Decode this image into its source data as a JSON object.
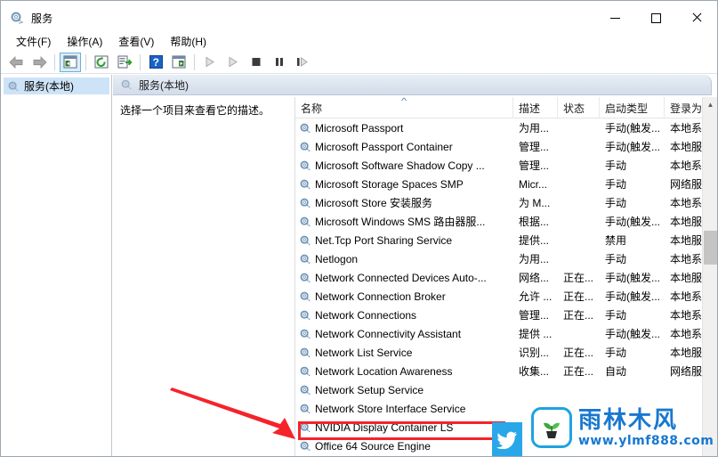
{
  "window": {
    "title": "服务",
    "icon": "services-gear-icon",
    "minimize_label": "最小化",
    "maximize_label": "最大化",
    "close_label": "关闭"
  },
  "menu": {
    "items": [
      {
        "label": "文件(F)",
        "name": "menu-file"
      },
      {
        "label": "操作(A)",
        "name": "menu-action"
      },
      {
        "label": "查看(V)",
        "name": "menu-view"
      },
      {
        "label": "帮助(H)",
        "name": "menu-help"
      }
    ]
  },
  "toolbar": {
    "buttons": [
      {
        "icon": "back-arrow-icon",
        "tooltip": "后退"
      },
      {
        "icon": "forward-arrow-icon",
        "tooltip": "前进"
      },
      {
        "icon": "show-tree-pane-icon",
        "tooltip": "显示/隐藏控制台树"
      },
      {
        "icon": "refresh-icon",
        "tooltip": "刷新"
      },
      {
        "icon": "export-list-icon",
        "tooltip": "导出列表"
      },
      {
        "icon": "help-icon",
        "tooltip": "帮助"
      },
      {
        "icon": "properties-icon",
        "tooltip": "属性"
      },
      {
        "icon": "start-service-icon",
        "tooltip": "启动服务"
      },
      {
        "icon": "restart-service-icon",
        "tooltip": "重启动服务"
      },
      {
        "icon": "stop-service-icon",
        "tooltip": "停止服务"
      },
      {
        "icon": "pause-service-icon",
        "tooltip": "暂停服务"
      },
      {
        "icon": "resume-service-icon",
        "tooltip": "恢复服务"
      }
    ]
  },
  "tree": {
    "root_label": "服务(本地)"
  },
  "right_pane": {
    "header_label": "服务(本地)",
    "description_placeholder": "选择一个项目来查看它的描述。"
  },
  "list": {
    "columns": [
      {
        "label": "名称",
        "name": "column-name",
        "sorted": "asc"
      },
      {
        "label": "描述",
        "name": "column-description"
      },
      {
        "label": "状态",
        "name": "column-status"
      },
      {
        "label": "启动类型",
        "name": "column-startup-type"
      },
      {
        "label": "登录为",
        "name": "column-log-on-as"
      }
    ],
    "rows": [
      {
        "name": "Microsoft Passport",
        "desc": "为用...",
        "status": "",
        "startup": "手动(触发...",
        "logon": "本地系"
      },
      {
        "name": "Microsoft Passport Container",
        "desc": "管理...",
        "status": "",
        "startup": "手动(触发...",
        "logon": "本地服"
      },
      {
        "name": "Microsoft Software Shadow Copy ...",
        "desc": "管理...",
        "status": "",
        "startup": "手动",
        "logon": "本地系"
      },
      {
        "name": "Microsoft Storage Spaces SMP",
        "desc": "Micr...",
        "status": "",
        "startup": "手动",
        "logon": "网络服"
      },
      {
        "name": "Microsoft Store 安装服务",
        "desc": "为 M...",
        "status": "",
        "startup": "手动",
        "logon": "本地系"
      },
      {
        "name": "Microsoft Windows SMS 路由器服...",
        "desc": "根据...",
        "status": "",
        "startup": "手动(触发...",
        "logon": "本地服"
      },
      {
        "name": "Net.Tcp Port Sharing Service",
        "desc": "提供...",
        "status": "",
        "startup": "禁用",
        "logon": "本地服"
      },
      {
        "name": "Netlogon",
        "desc": "为用...",
        "status": "",
        "startup": "手动",
        "logon": "本地系"
      },
      {
        "name": "Network Connected Devices Auto-...",
        "desc": "网络...",
        "status": "正在...",
        "startup": "手动(触发...",
        "logon": "本地服"
      },
      {
        "name": "Network Connection Broker",
        "desc": "允许 ...",
        "status": "正在...",
        "startup": "手动(触发...",
        "logon": "本地系"
      },
      {
        "name": "Network Connections",
        "desc": "管理...",
        "status": "正在...",
        "startup": "手动",
        "logon": "本地系"
      },
      {
        "name": "Network Connectivity Assistant",
        "desc": "提供 ...",
        "status": "",
        "startup": "手动(触发...",
        "logon": "本地系"
      },
      {
        "name": "Network List Service",
        "desc": "识别...",
        "status": "正在...",
        "startup": "手动",
        "logon": "本地服"
      },
      {
        "name": "Network Location Awareness",
        "desc": "收集...",
        "status": "正在...",
        "startup": "自动",
        "logon": "网络服"
      },
      {
        "name": "Network Setup Service",
        "desc": "",
        "status": "",
        "startup": "",
        "logon": ""
      },
      {
        "name": "Network Store Interface Service",
        "desc": "",
        "status": "",
        "startup": "",
        "logon": ""
      },
      {
        "name": "NVIDIA Display Container LS",
        "desc": "",
        "status": "",
        "startup": "",
        "logon": ""
      },
      {
        "name": "Office 64 Source Engine",
        "desc": "",
        "status": "",
        "startup": "",
        "logon": ""
      }
    ],
    "highlighted_row": "NVIDIA Display Container LS"
  },
  "scrollbar": {
    "up_arrow": "▲",
    "down_arrow": "▼"
  },
  "annotations": {
    "highlight_color": "#f5232a",
    "arrow_color": "#f5232a",
    "arrow_target": "NVIDIA Display Container LS"
  },
  "watermark": {
    "brand": "雨林木风",
    "url": "www.ylmf888.com",
    "brand_color": "#1878d0",
    "logo_name": "sprout-logo-icon"
  },
  "badge": {
    "name": "twitter-bird-icon",
    "color": "#29a7e8"
  }
}
